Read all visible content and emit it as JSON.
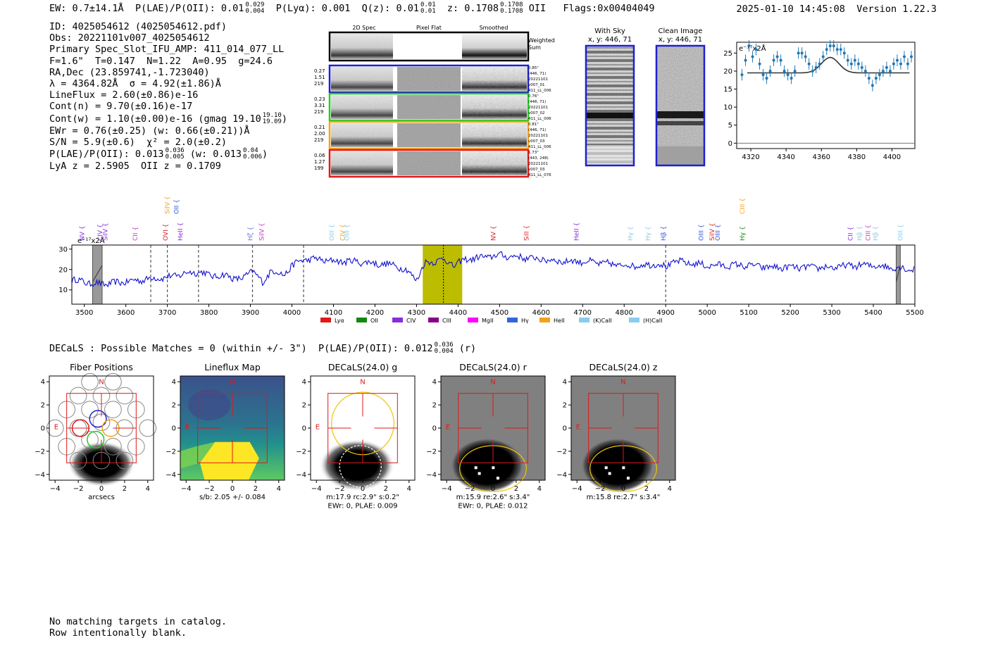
{
  "header": {
    "ew": "EW: 0.7±14.1Å",
    "plae_label": "P(LAE)/P(OII): 0.01",
    "plae_hi": "0.029",
    "plae_lo": "0.004",
    "plya": "P(Lyα): 0.001",
    "qz_label": "Q(z): 0.01",
    "qz_hi": "0.01",
    "qz_lo": "0.01",
    "z_label": "z: 0.1708",
    "z_hi": "0.1708",
    "z_lo": "0.1708",
    "z_line": "OII",
    "flags": "Flags:0x00404049",
    "timestamp": "2025-01-10 14:45:08",
    "version": "Version 1.22.3"
  },
  "info": {
    "id": "ID: 4025054612 (4025054612.pdf)",
    "obs": "Obs: 20221101v007_4025054612",
    "primary": "Primary Spec_Slot_IFU_AMP: 411_014_077_LL",
    "fparams": "F=1.6\"  T=0.147  N=1.22  A=0.95  g=24.6",
    "radec": "RA,Dec (23.859741,-1.723040)",
    "lambda": "λ = 4364.82Å  σ = 4.92(±1.86)Å",
    "lineflux": "LineFlux = 2.60(±0.86)e-16",
    "contn": "Cont(n) = 9.70(±0.16)e-17",
    "contw": "Cont(w) = 1.10(±0.00)e-16 (gmag 19.10",
    "gmag_hi": "19.10",
    "gmag_lo": "19.09",
    "contw_end": ")",
    "ewr": "EWr = 0.76(±0.25) (w: 0.66(±0.21))Å",
    "sn": "S/N = 5.9(±0.6)  χ² = 2.0(±0.2)",
    "plae2": "P(LAE)/P(OII): 0.013",
    "plae2_hi": "0.036",
    "plae2_lo": "0.005",
    "plae2_w": "(w: 0.013",
    "plae2_w_hi": "0.04",
    "plae2_w_lo": "0.006",
    "plae2_end": ")",
    "lya": "LyA z = 2.5905  OII z = 0.1709"
  },
  "cutouts": {
    "col_headers": [
      "2D Spec",
      "Pixel Flat",
      "Smoothed"
    ],
    "weighted_sum": [
      "Weighted",
      "Sum"
    ],
    "rows": [
      {
        "left": [
          "0.27",
          "1.51",
          "219"
        ],
        "right": [
          "0.85\"",
          "(446, 71)",
          "20221101",
          "v007_01",
          "411_LL_006"
        ],
        "color": "#1f1fd0"
      },
      {
        "left": [
          "0.23",
          "3.31",
          "219"
        ],
        "right": [
          "0.76\"",
          "(446, 71)",
          "20221101",
          "v007_02",
          "411_LL_006"
        ],
        "color": "#22cc22"
      },
      {
        "left": [
          "0.21",
          "2.00",
          "219"
        ],
        "right": [
          "0.81\"",
          "(446, 71)",
          "20221101",
          "v007_03",
          "411_LL_006"
        ],
        "color": "#f2a21a"
      },
      {
        "left": [
          "0.06",
          "1.27",
          "199"
        ],
        "right": [
          "1.73\"",
          "(443, 248)",
          "20221101",
          "v007_03",
          "411_LL_076"
        ],
        "color": "#e01818"
      }
    ],
    "with_sky_title": [
      "With Sky",
      "x, y: 446, 71"
    ],
    "clean_title": [
      "Clean Image",
      "x, y: 446, 71"
    ]
  },
  "zoom_chart": {
    "type": "scatter",
    "unit_label": "e⁻¹⁷x2Å",
    "xlim": [
      4312,
      4413
    ],
    "ylim": [
      -1.5,
      28
    ],
    "xticks": [
      4320,
      4340,
      4360,
      4380,
      4400
    ],
    "yticks": [
      0,
      5,
      10,
      15,
      20,
      25
    ],
    "x": [
      4315,
      4317,
      4319,
      4321,
      4323,
      4325,
      4327,
      4329,
      4331,
      4333,
      4335,
      4337,
      4339,
      4341,
      4343,
      4345,
      4347,
      4349,
      4351,
      4353,
      4355,
      4357,
      4359,
      4361,
      4363,
      4365,
      4367,
      4369,
      4371,
      4373,
      4375,
      4377,
      4379,
      4381,
      4383,
      4385,
      4387,
      4389,
      4391,
      4393,
      4395,
      4397,
      4399,
      4401,
      4403,
      4405,
      4407,
      4409,
      4411
    ],
    "y": [
      19,
      23,
      27,
      24,
      26,
      22,
      19,
      18,
      20,
      23,
      24,
      23,
      20,
      19,
      18,
      20,
      25,
      25,
      24,
      22,
      20,
      21,
      22,
      24,
      26,
      27,
      27,
      26,
      26,
      25,
      23,
      22,
      23,
      22,
      21,
      20,
      18,
      16,
      18,
      19,
      20,
      21,
      20,
      22,
      23,
      22,
      24,
      22,
      24
    ],
    "yerr": 1.6,
    "model_baseline": 19.5,
    "model_peak": 23.8,
    "model_center": 4365,
    "model_sigma": 4.9
  },
  "spectrum": {
    "type": "line",
    "unit_label": "e⁻¹⁷x2Å",
    "xlim": [
      3470,
      5500
    ],
    "ylim": [
      3,
      32
    ],
    "xticks": [
      3500,
      3600,
      3700,
      3800,
      3900,
      4000,
      4100,
      4200,
      4300,
      4400,
      4500,
      4600,
      4700,
      4800,
      4900,
      5000,
      5100,
      5200,
      5300,
      5400,
      5500
    ],
    "yticks": [
      10,
      20,
      30
    ],
    "highlight_range": [
      4315,
      4410
    ],
    "highlight_center": 4364.8,
    "masked_ranges": [
      [
        3520,
        3543
      ],
      [
        5455,
        5465
      ]
    ],
    "dashed_lines": [
      3660,
      3700,
      3775,
      3905,
      4028,
      4900
    ],
    "line_labels": [
      {
        "x": 3500,
        "label": "NV",
        "color": "#8a2be2",
        "tier": 2
      },
      {
        "x": 3543,
        "label": "CIV",
        "color": "#8a2be2",
        "tier": 2
      },
      {
        "x": 3556,
        "label": "SiIV",
        "color": "#8a2be2",
        "tier": 2
      },
      {
        "x": 3628,
        "label": "CII",
        "color": "#cc33cc",
        "tier": 2
      },
      {
        "x": 3701,
        "label": "OVI",
        "color": "#dd2222",
        "tier": 2
      },
      {
        "x": 3705,
        "label": "SiIV",
        "color": "#f2a21a",
        "tier": 0
      },
      {
        "x": 3727,
        "label": "OII",
        "color": "#3355dd",
        "tier": 0
      },
      {
        "x": 3736,
        "label": "HeII",
        "color": "#8a2be2",
        "tier": 2
      },
      {
        "x": 3905,
        "label": "Hζ",
        "color": "#6677dd",
        "tier": 2
      },
      {
        "x": 3932,
        "label": "SiIV",
        "color": "#cc33cc",
        "tier": 2
      },
      {
        "x": 4101,
        "label": "OIII",
        "color": "#88ccee",
        "tier": 2
      },
      {
        "x": 4127,
        "label": "CIV",
        "color": "#f2a21a",
        "tier": 2
      },
      {
        "x": 4137,
        "label": "OIII",
        "color": "#88ccee",
        "tier": 2
      },
      {
        "x": 4490,
        "label": "NV",
        "color": "#dd2222",
        "tier": 2
      },
      {
        "x": 4570,
        "label": "SiII",
        "color": "#dd2222",
        "tier": 2
      },
      {
        "x": 4690,
        "label": "HeII",
        "color": "#8a2be2",
        "tier": 2
      },
      {
        "x": 4820,
        "label": "Hγ",
        "color": "#88ccee",
        "tier": 2
      },
      {
        "x": 4862,
        "label": "Hγ",
        "color": "#88ccee",
        "tier": 2
      },
      {
        "x": 4900,
        "label": "Hβ",
        "color": "#3355dd",
        "tier": 2
      },
      {
        "x": 4990,
        "label": "OIII",
        "color": "#3355dd",
        "tier": 2
      },
      {
        "x": 5017,
        "label": "SiIV",
        "color": "#dd2222",
        "tier": 2
      },
      {
        "x": 5030,
        "label": "OIII",
        "color": "#3355dd",
        "tier": 2
      },
      {
        "x": 5090,
        "label": "CIII",
        "color": "#f2a21a",
        "tier": 0
      },
      {
        "x": 5090,
        "label": "Hγ",
        "color": "#118811",
        "tier": 2
      },
      {
        "x": 5350,
        "label": "CII",
        "color": "#8a2be2",
        "tier": 2
      },
      {
        "x": 5372,
        "label": "Hβ",
        "color": "#88ccee",
        "tier": 2
      },
      {
        "x": 5392,
        "label": "CIII",
        "color": "#cc33cc",
        "tier": 2
      },
      {
        "x": 5410,
        "label": "Hβ",
        "color": "#88ccee",
        "tier": 2
      },
      {
        "x": 5470,
        "label": "OIII",
        "color": "#88ccee",
        "tier": 2
      }
    ],
    "legend": [
      {
        "label": "Lyα",
        "color": "#e01818"
      },
      {
        "label": "OII",
        "color": "#118811"
      },
      {
        "label": "CIV",
        "color": "#8a2be2"
      },
      {
        "label": "CIII",
        "color": "#880088"
      },
      {
        "label": "MgII",
        "color": "#ff00ff"
      },
      {
        "label": "Hγ",
        "color": "#3366dd"
      },
      {
        "label": "HeII",
        "color": "#f2a21a"
      },
      {
        "label": "(K)CaII",
        "color": "#88ccee"
      },
      {
        "label": "(H)CaII",
        "color": "#88ccee"
      }
    ],
    "anchors_x": [
      3470,
      3500,
      3520,
      3560,
      3600,
      3640,
      3680,
      3700,
      3740,
      3780,
      3800,
      3840,
      3880,
      3905,
      3930,
      3950,
      3980,
      4000,
      4030,
      4060,
      4100,
      4150,
      4200,
      4250,
      4280,
      4300,
      4320,
      4340,
      4364,
      4390,
      4420,
      4460,
      4500,
      4550,
      4600,
      4650,
      4700,
      4750,
      4800,
      4850,
      4880,
      4900,
      4920,
      4960,
      5000,
      5050,
      5100,
      5150,
      5200,
      5250,
      5300,
      5350,
      5400,
      5450,
      5500
    ],
    "anchors_y": [
      15,
      14,
      13,
      13,
      14,
      15,
      16,
      16,
      18,
      19,
      17,
      17,
      15,
      20,
      13,
      20,
      17,
      22,
      25,
      25,
      24,
      24,
      23,
      22,
      19,
      15,
      23,
      24,
      25,
      22,
      25,
      26,
      27,
      26,
      25,
      24,
      24,
      23,
      22,
      22,
      23,
      21,
      24,
      23,
      22,
      22,
      22,
      21,
      21,
      21,
      21,
      22,
      22,
      21,
      20
    ]
  },
  "decals_line": {
    "text": "DECaLS : Possible Matches = 0 (within +/- 3\")  P(LAE)/P(OII): 0.012",
    "hi": "0.036",
    "lo": "0.004",
    "end": "(r)"
  },
  "stamps": [
    {
      "title": "Fiber Positions",
      "captions": [
        "arcsecs"
      ]
    },
    {
      "title": "Lineflux Map",
      "captions": [
        "s/b: 2.05 +/- 0.084"
      ]
    },
    {
      "title": "DECaLS(24.0) g",
      "captions": [
        "m:17.9 rc:2.9\"  s:0.2\"",
        "EWr: 0, PLAE: 0.009"
      ]
    },
    {
      "title": "DECaLS(24.0) r",
      "captions": [
        "m:15.9  re:2.6\"  s:3.4\"",
        "EWr: 0, PLAE: 0.012"
      ]
    },
    {
      "title": "DECaLS(24.0) z",
      "captions": [
        "m:15.8  re:2.7\"  s:3.4\""
      ]
    }
  ],
  "stamp_axis": {
    "ticks": [
      -4,
      -2,
      0,
      2,
      4
    ],
    "north": "N",
    "east": "E"
  },
  "footer": [
    "No matching targets in catalog.",
    "Row intentionally blank."
  ]
}
